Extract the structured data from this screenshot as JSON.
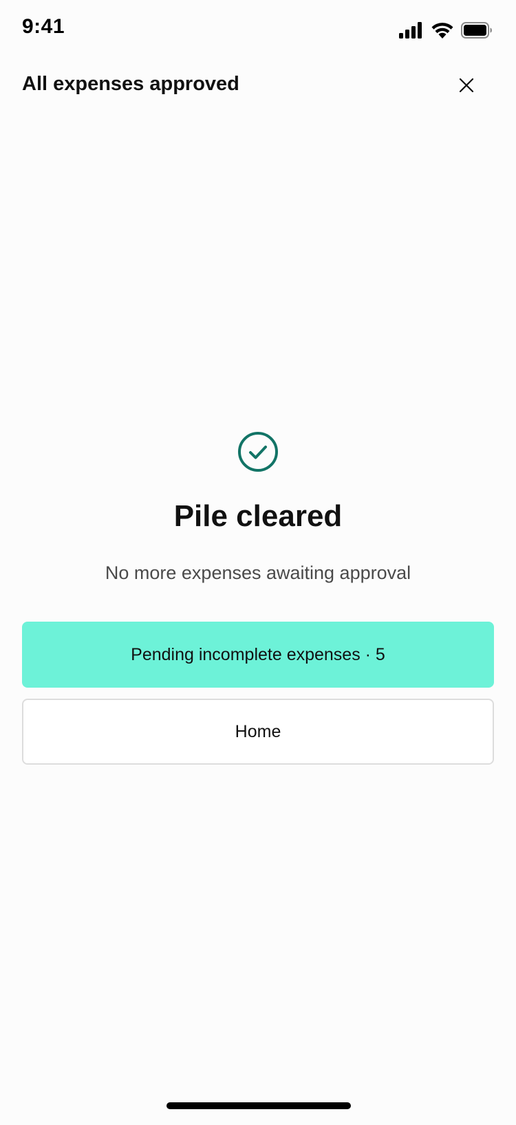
{
  "status_bar": {
    "time": "9:41",
    "icons": [
      "cellular-signal-icon",
      "wifi-icon",
      "battery-icon"
    ]
  },
  "header": {
    "title": "All expenses approved",
    "close_icon": "close-icon"
  },
  "content": {
    "status_icon": "check-circle-icon",
    "title": "Pile cleared",
    "subtitle": "No more expenses awaiting approval"
  },
  "actions": {
    "primary_label": "Pending incomplete expenses · 5",
    "secondary_label": "Home"
  },
  "colors": {
    "accent": "#6df2d8",
    "check": "#127466",
    "background": "#fcfcfc",
    "border": "#dddddd"
  }
}
